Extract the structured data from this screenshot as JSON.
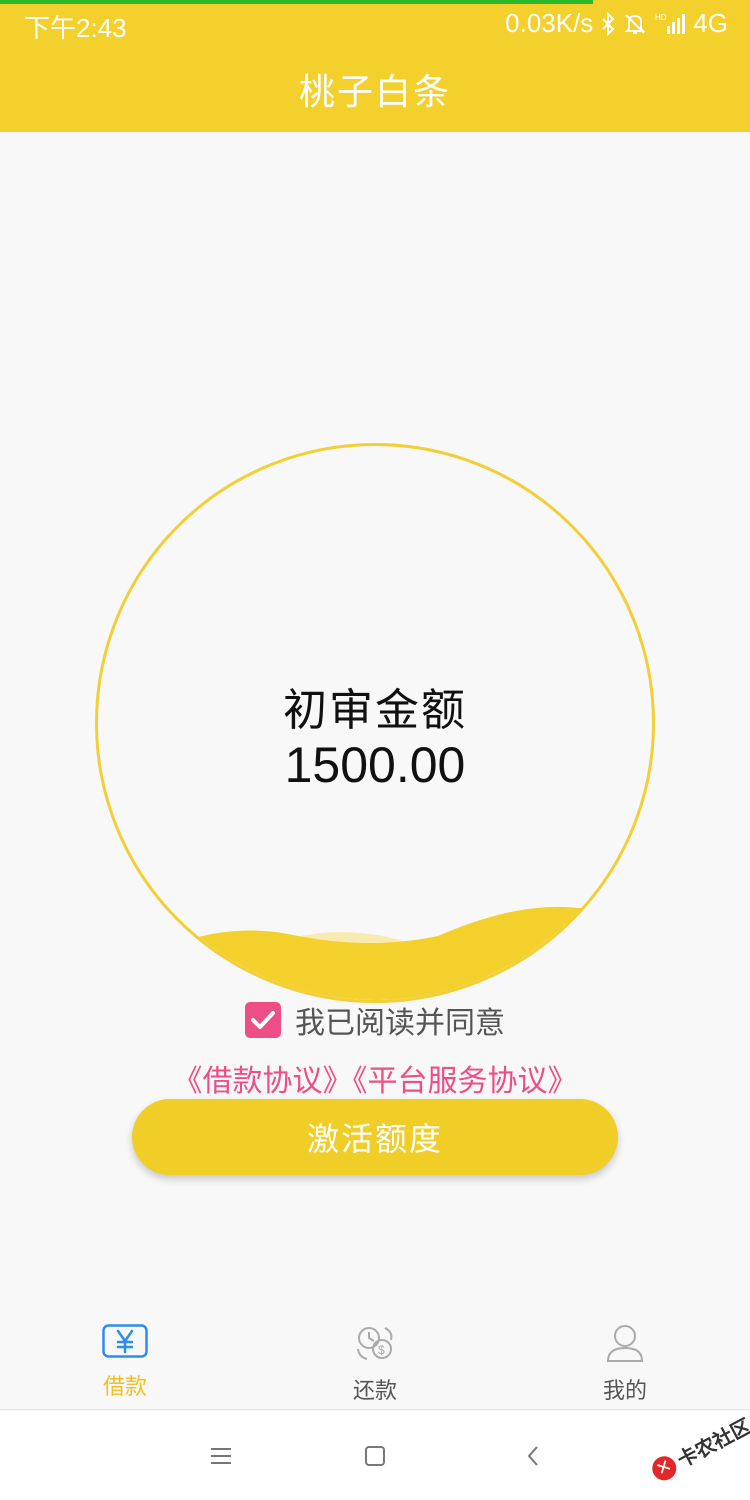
{
  "status_bar": {
    "time": "下午2:43",
    "network_speed": "0.03K/s",
    "network_type": "4G",
    "icons": [
      "bluetooth-icon",
      "mute-bell-icon",
      "hd-signal-icon"
    ]
  },
  "page_progress": 0.79,
  "header": {
    "title": "桃子白条"
  },
  "quota": {
    "label": "初审金额",
    "amount": "1500.00"
  },
  "agreement": {
    "checked": true,
    "text": "我已阅读并同意",
    "link_loan": "《借款协议》",
    "link_platform": "《平台服务协议》"
  },
  "activate_button": {
    "label": "激活额度"
  },
  "tabs": [
    {
      "label": "借款",
      "icon": "yen-icon",
      "active": true
    },
    {
      "label": "还款",
      "icon": "repay-icon",
      "active": false
    },
    {
      "label": "我的",
      "icon": "user-icon",
      "active": false
    }
  ],
  "system_nav": [
    "menu-icon",
    "home-icon",
    "back-icon"
  ],
  "watermark": {
    "text": "卡农社区"
  },
  "colors": {
    "brand_yellow": "#f3d02b",
    "accent_pink": "#ee4e86",
    "tab_active": "#f0c11e"
  }
}
